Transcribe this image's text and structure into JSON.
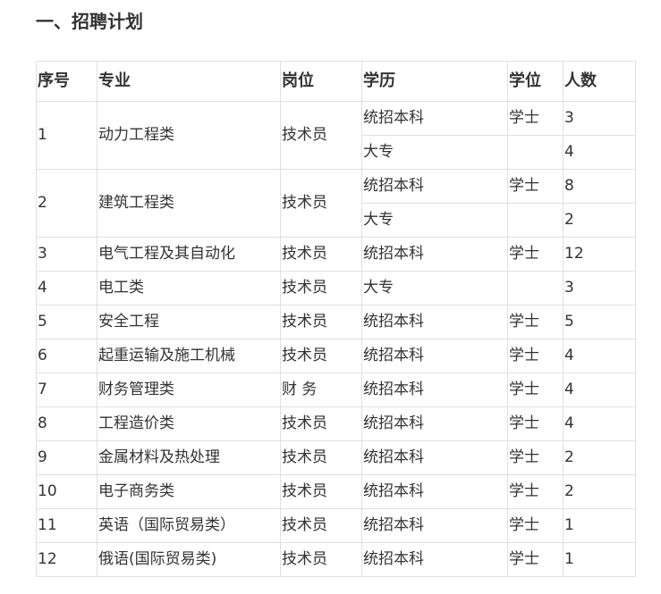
{
  "section": {
    "title": "一、招聘计划"
  },
  "table": {
    "headers": [
      "序号",
      "专业",
      "岗位",
      "学历",
      "学位",
      "人数"
    ],
    "rows": [
      {
        "no": "1",
        "major": "动力工程类",
        "post": "技术员",
        "entries": [
          {
            "edu": "统招本科",
            "degree": "学士",
            "count": "3"
          },
          {
            "edu": "大专",
            "degree": "",
            "count": "4"
          }
        ]
      },
      {
        "no": "2",
        "major": "建筑工程类",
        "post": "技术员",
        "entries": [
          {
            "edu": "统招本科",
            "degree": "学士",
            "count": "8"
          },
          {
            "edu": "大专",
            "degree": "",
            "count": "2"
          }
        ]
      },
      {
        "no": "3",
        "major": "电气工程及其自动化",
        "post": "技术员",
        "entries": [
          {
            "edu": "统招本科",
            "degree": "学士",
            "count": "12"
          }
        ]
      },
      {
        "no": "4",
        "major": "电工类",
        "post": "技术员",
        "entries": [
          {
            "edu": "大专",
            "degree": "",
            "count": "3"
          }
        ]
      },
      {
        "no": "5",
        "major": "安全工程",
        "post": "技术员",
        "entries": [
          {
            "edu": "统招本科",
            "degree": "学士",
            "count": "5"
          }
        ]
      },
      {
        "no": "6",
        "major": "起重运输及施工机械",
        "post": "技术员",
        "entries": [
          {
            "edu": "统招本科",
            "degree": "学士",
            "count": "4"
          }
        ]
      },
      {
        "no": "7",
        "major": "财务管理类",
        "post": "财 务",
        "entries": [
          {
            "edu": "统招本科",
            "degree": "学士",
            "count": "4"
          }
        ]
      },
      {
        "no": "8",
        "major": "工程造价类",
        "post": "技术员",
        "entries": [
          {
            "edu": "统招本科",
            "degree": "学士",
            "count": "4"
          }
        ]
      },
      {
        "no": "9",
        "major": "金属材料及热处理",
        "post": "技术员",
        "entries": [
          {
            "edu": "统招本科",
            "degree": "学士",
            "count": "2"
          }
        ]
      },
      {
        "no": "10",
        "major": "电子商务类",
        "post": "技术员",
        "entries": [
          {
            "edu": "统招本科",
            "degree": "学士",
            "count": "2"
          }
        ]
      },
      {
        "no": "11",
        "major": "英语（国际贸易类）",
        "post": "技术员",
        "entries": [
          {
            "edu": "统招本科",
            "degree": "学士",
            "count": "1"
          }
        ]
      },
      {
        "no": "12",
        "major": "俄语(国际贸易类)",
        "post": "技术员",
        "entries": [
          {
            "edu": "统招本科",
            "degree": "学士",
            "count": "1"
          }
        ]
      }
    ]
  }
}
